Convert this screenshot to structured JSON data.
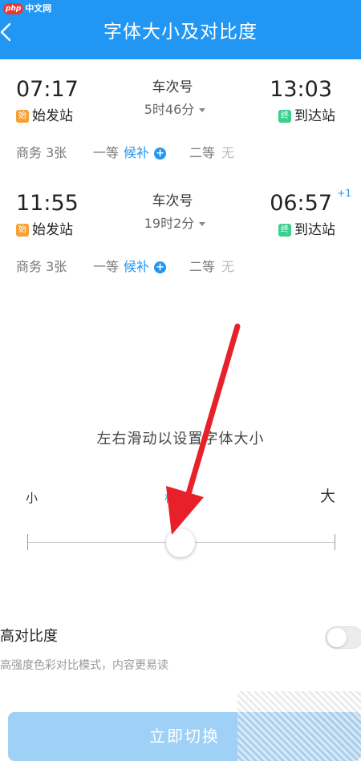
{
  "header": {
    "title": "字体大小及对比度",
    "background": "#2196f3",
    "back_icon": "chevron-left-icon"
  },
  "watermark_logo": {
    "badge": "php",
    "text": "中文网"
  },
  "trains": [
    {
      "departure_time": "07:17",
      "arrival_time": "13:03",
      "arrival_day_offset": "",
      "departure_station": "始发站",
      "departure_badge": "始",
      "arrival_station": "到达站",
      "arrival_badge": "终",
      "train_number": "车次号",
      "duration": "5时46分",
      "seats": {
        "business": "商务 3张",
        "first_label": "一等",
        "first_status": "候补",
        "second_label": "二等",
        "second_status": "无"
      }
    },
    {
      "departure_time": "11:55",
      "arrival_time": "06:57",
      "arrival_day_offset": "+1",
      "departure_station": "始发站",
      "departure_badge": "始",
      "arrival_station": "到达站",
      "arrival_badge": "终",
      "train_number": "车次号",
      "duration": "19时2分",
      "seats": {
        "business": "商务 3张",
        "first_label": "一等",
        "first_status": "候补",
        "second_label": "二等",
        "second_status": "无"
      }
    }
  ],
  "font_slider": {
    "hint": "左右滑动以设置字体大小",
    "small_label": "小",
    "standard_label": "标准",
    "large_label": "大",
    "value": 0.5
  },
  "contrast": {
    "title": "高对比度",
    "description": "高强度色彩对比模式，内容更易读",
    "enabled": false
  },
  "apply_button": {
    "label": "立即切换",
    "color": "#9fd0f6"
  },
  "annotation_arrow": {
    "color": "#e8202a"
  }
}
